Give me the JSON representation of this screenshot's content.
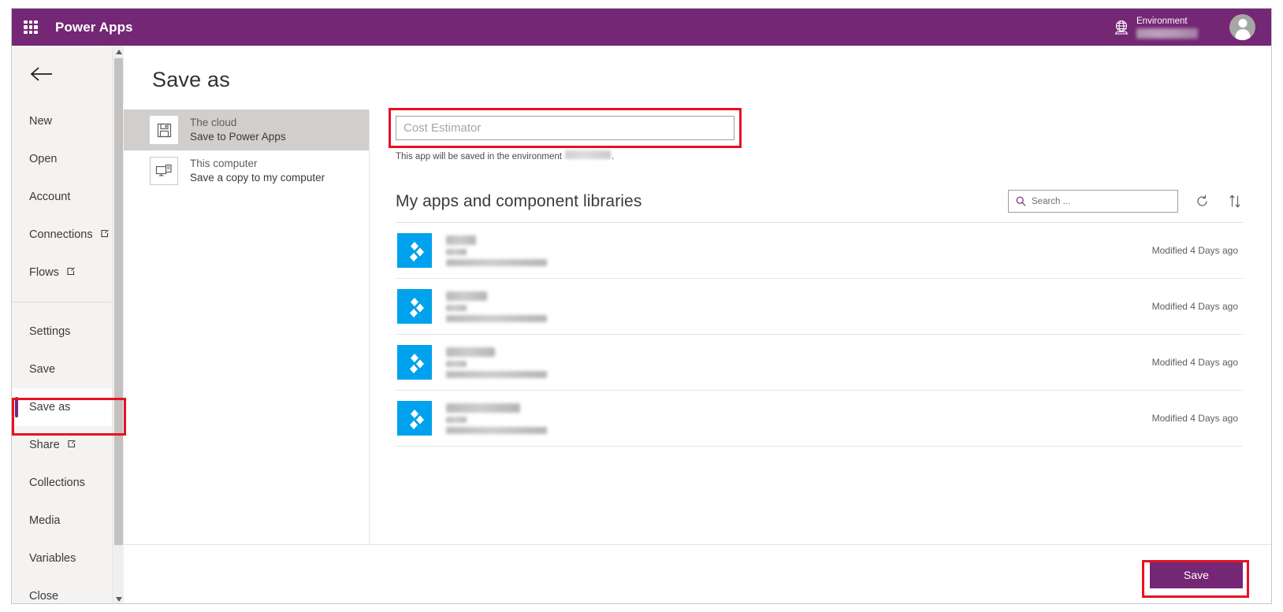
{
  "topbar": {
    "waffle_icon": "app-launcher-icon",
    "brand": "Power Apps",
    "environment_label": "Environment",
    "environment_name_redacted": true,
    "globe_icon": "environment-globe-icon",
    "avatar_icon": "user-avatar-icon"
  },
  "sidebar": {
    "back_icon": "back-arrow-icon",
    "items": [
      {
        "label": "New",
        "external": false,
        "selected": false
      },
      {
        "label": "Open",
        "external": false,
        "selected": false
      },
      {
        "label": "Account",
        "external": false,
        "selected": false
      },
      {
        "label": "Connections",
        "external": true,
        "selected": false
      },
      {
        "label": "Flows",
        "external": true,
        "selected": false
      },
      {
        "label": "Settings",
        "external": false,
        "selected": false
      },
      {
        "label": "Save",
        "external": false,
        "selected": false
      },
      {
        "label": "Save as",
        "external": false,
        "selected": true
      },
      {
        "label": "Share",
        "external": true,
        "selected": false
      },
      {
        "label": "Collections",
        "external": false,
        "selected": false
      },
      {
        "label": "Media",
        "external": false,
        "selected": false
      },
      {
        "label": "Variables",
        "external": false,
        "selected": false
      },
      {
        "label": "Close",
        "external": false,
        "selected": false
      }
    ],
    "scrollbar": {
      "up_icon": "scroll-up-arrow-icon",
      "down_icon": "scroll-down-arrow-icon"
    }
  },
  "main": {
    "page_title": "Save as",
    "destinations": [
      {
        "title": "The cloud",
        "subtitle": "Save to Power Apps",
        "icon": "floppy-disk-icon",
        "selected": true
      },
      {
        "title": "This computer",
        "subtitle": "Save a copy to my computer",
        "icon": "computer-monitor-icon",
        "selected": false
      }
    ],
    "name_field": {
      "value": "Cost Estimator",
      "placeholder": "Cost Estimator"
    },
    "environment_note_prefix": "This app will be saved in the environment",
    "environment_note_suffix": ".",
    "list": {
      "title": "My apps and component libraries",
      "search_placeholder": "Search ...",
      "search_icon": "search-icon",
      "refresh_icon": "refresh-icon",
      "sort_icon": "sort-arrows-icon",
      "rows": [
        {
          "name_redacted": true,
          "name_width": 38,
          "detail_width": 128,
          "modified": "Modified 4 Days ago",
          "logo": "powerapps-logo-icon"
        },
        {
          "name_redacted": true,
          "name_width": 52,
          "detail_width": 128,
          "modified": "Modified 4 Days ago",
          "logo": "powerapps-logo-icon"
        },
        {
          "name_redacted": true,
          "name_width": 62,
          "detail_width": 128,
          "modified": "Modified 4 Days ago",
          "logo": "powerapps-logo-icon"
        },
        {
          "name_redacted": true,
          "name_width": 94,
          "detail_width": 128,
          "modified": "Modified 4 Days ago",
          "logo": "powerapps-logo-icon"
        }
      ]
    },
    "save_button": "Save"
  },
  "colors": {
    "brand_purple": "#742774",
    "annotation_red": "#e81123",
    "app_logo_blue": "#00a2ed",
    "sidebar_bg": "#f4f3f2",
    "selected_dest_bg": "#d0cfce"
  }
}
